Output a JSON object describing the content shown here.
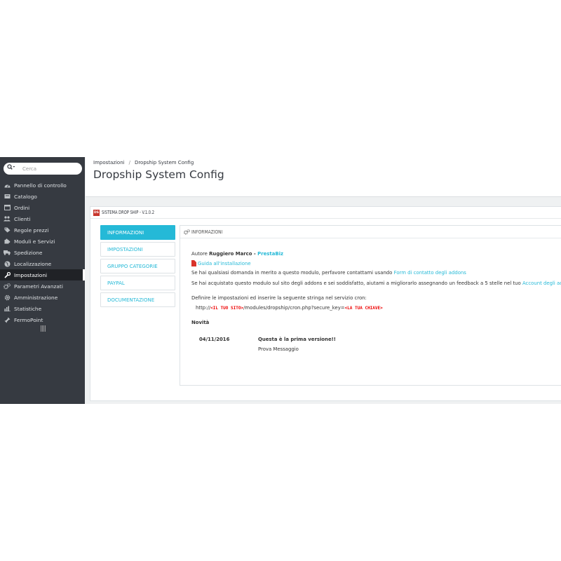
{
  "search": {
    "placeholder": "Cerca"
  },
  "sidebar": {
    "items": [
      {
        "label": "Pannello di controllo",
        "icon": "dashboard-icon"
      },
      {
        "label": "Catalogo",
        "icon": "catalog-icon"
      },
      {
        "label": "Ordini",
        "icon": "orders-icon"
      },
      {
        "label": "Clienti",
        "icon": "customers-icon"
      },
      {
        "label": "Regole prezzi",
        "icon": "tags-icon"
      },
      {
        "label": "Moduli e Servizi",
        "icon": "puzzle-icon"
      },
      {
        "label": "Spedizione",
        "icon": "truck-icon"
      },
      {
        "label": "Localizzazione",
        "icon": "globe-icon"
      },
      {
        "label": "Impostazioni",
        "icon": "wrench-icon"
      },
      {
        "label": "Parametri Avanzati",
        "icon": "cogs-icon"
      },
      {
        "label": "Amministrazione",
        "icon": "gear-icon"
      },
      {
        "label": "Statistiche",
        "icon": "bar-chart-icon"
      },
      {
        "label": "FermoPoint",
        "icon": "pin-icon"
      }
    ]
  },
  "breadcrumb": {
    "parent": "Impostazioni",
    "current": "Dropship System Config"
  },
  "page_title": "Dropship System Config",
  "panel": {
    "logo_text": "DS",
    "title": "SISTEMA DROP SHIP - V.1.0.2"
  },
  "tabs": [
    {
      "label": "INFORMAZIONI",
      "active": true
    },
    {
      "label": "IMPOSTAZIONI",
      "active": false
    },
    {
      "label": "GRUPPO CATEGORIE",
      "active": false
    },
    {
      "label": "PAYPAL",
      "active": false
    },
    {
      "label": "DOCUMENTAZIONE",
      "active": false
    }
  ],
  "info": {
    "title": "INFORMAZIONI",
    "author_label": "Autore",
    "author_name": "Ruggiero Marco",
    "author_sep": " - ",
    "author_company": "PrestaBiz",
    "guide_link": "Guida all'installazione",
    "contact_text": "Se hai qualsiasi domanda in merito a questo modulo, perfavore contattami usando",
    "contact_link": "Form di contatto degli addons",
    "feedback_text": "Se hai acquistato questo modulo sul sito degli addons e sei soddisfatto, aiutami a migliorarlo assegnando un feedback a 5 stelle nel tuo",
    "feedback_link": "Account degli addons",
    "cron_intro": "Definire le impostazioni ed inserire la seguente stringa nel servizio cron:",
    "cron_prefix": "http://",
    "cron_site": "<IL TUO SITO>",
    "cron_path": "/modules/dropship/cron.php?secure_key=",
    "cron_key": "<LA TUA CHIAVE>",
    "news_title": "Novità",
    "news_date": "04/11/2016",
    "news_headline": "Questa è la prima versione!!",
    "news_message": "Prova Messaggio"
  },
  "colors": {
    "sidebar_bg": "#363a41",
    "accent": "#25b9d7",
    "page_bg": "#eff1f2"
  }
}
